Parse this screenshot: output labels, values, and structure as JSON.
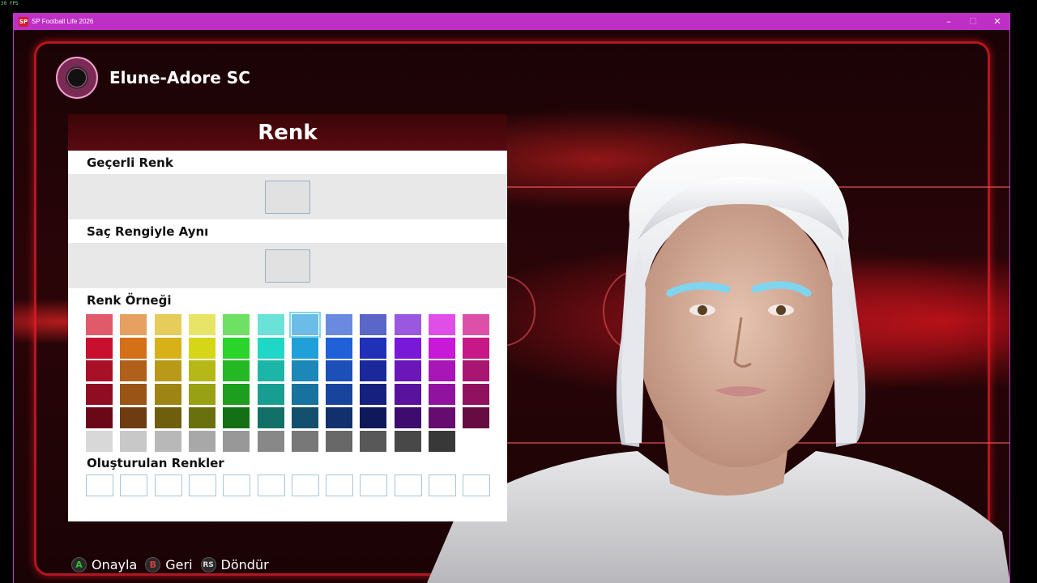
{
  "fps": "30 FPS",
  "window": {
    "title": "SP Football Life 2026",
    "icon_text": "SP",
    "minimize": "–",
    "maximize": "☐",
    "close": "✕"
  },
  "club": {
    "name": "Elune-Adore SC"
  },
  "panel": {
    "title": "Renk",
    "current_label": "Geçerli Renk",
    "hair_label": "Saç Rengiyle Aynı",
    "palette_label": "Renk Örneği",
    "created_label": "Oluşturulan Renkler"
  },
  "palette": {
    "rows": [
      [
        "#e05a6a",
        "#e6a060",
        "#e6cc5a",
        "#e8e468",
        "#6ee064",
        "#6ae2d8",
        "#6cbce8",
        "#6a8ae0",
        "#5a66c8",
        "#9a58e0",
        "#e04ee8",
        "#dc50a8"
      ],
      [
        "#c8102e",
        "#d47018",
        "#d8b018",
        "#d6d618",
        "#2ad42a",
        "#20d6c6",
        "#20a0d8",
        "#2060d8",
        "#2030b8",
        "#7a18d8",
        "#c818d8",
        "#c81888"
      ],
      [
        "#a81028",
        "#b0601a",
        "#b89a18",
        "#b6b818",
        "#24b824",
        "#1cb6a8",
        "#1c88b8",
        "#1c50b8",
        "#1a289a",
        "#6a16b8",
        "#a816b8",
        "#a81672"
      ],
      [
        "#900c22",
        "#9a5416",
        "#9e8414",
        "#98a014",
        "#1e9e1e",
        "#189e90",
        "#18729e",
        "#18449e",
        "#16207e",
        "#58129e",
        "#90129e",
        "#90125e"
      ],
      [
        "#6a0818",
        "#6e3c10",
        "#6e5e0e",
        "#6a700e",
        "#147014",
        "#127066",
        "#12506e",
        "#12306e",
        "#10185c",
        "#3e0c6e",
        "#660c6e",
        "#660c42"
      ],
      [
        "#d8d8d8",
        "#c8c8c8",
        "#b8b8b8",
        "#a8a8a8",
        "#989898",
        "#888888",
        "#787878",
        "#686868",
        "#585858",
        "#484848",
        "#383838"
      ]
    ],
    "selected": "0-6"
  },
  "created": {
    "count_label": ""
  },
  "prompts": [
    {
      "key": "A",
      "label": "Onayla",
      "color": "#2ec22e"
    },
    {
      "key": "B",
      "label": "Geri",
      "color": "#e03a3a"
    },
    {
      "key": "RS",
      "label": "Döndür",
      "color": "#dddddd"
    }
  ]
}
